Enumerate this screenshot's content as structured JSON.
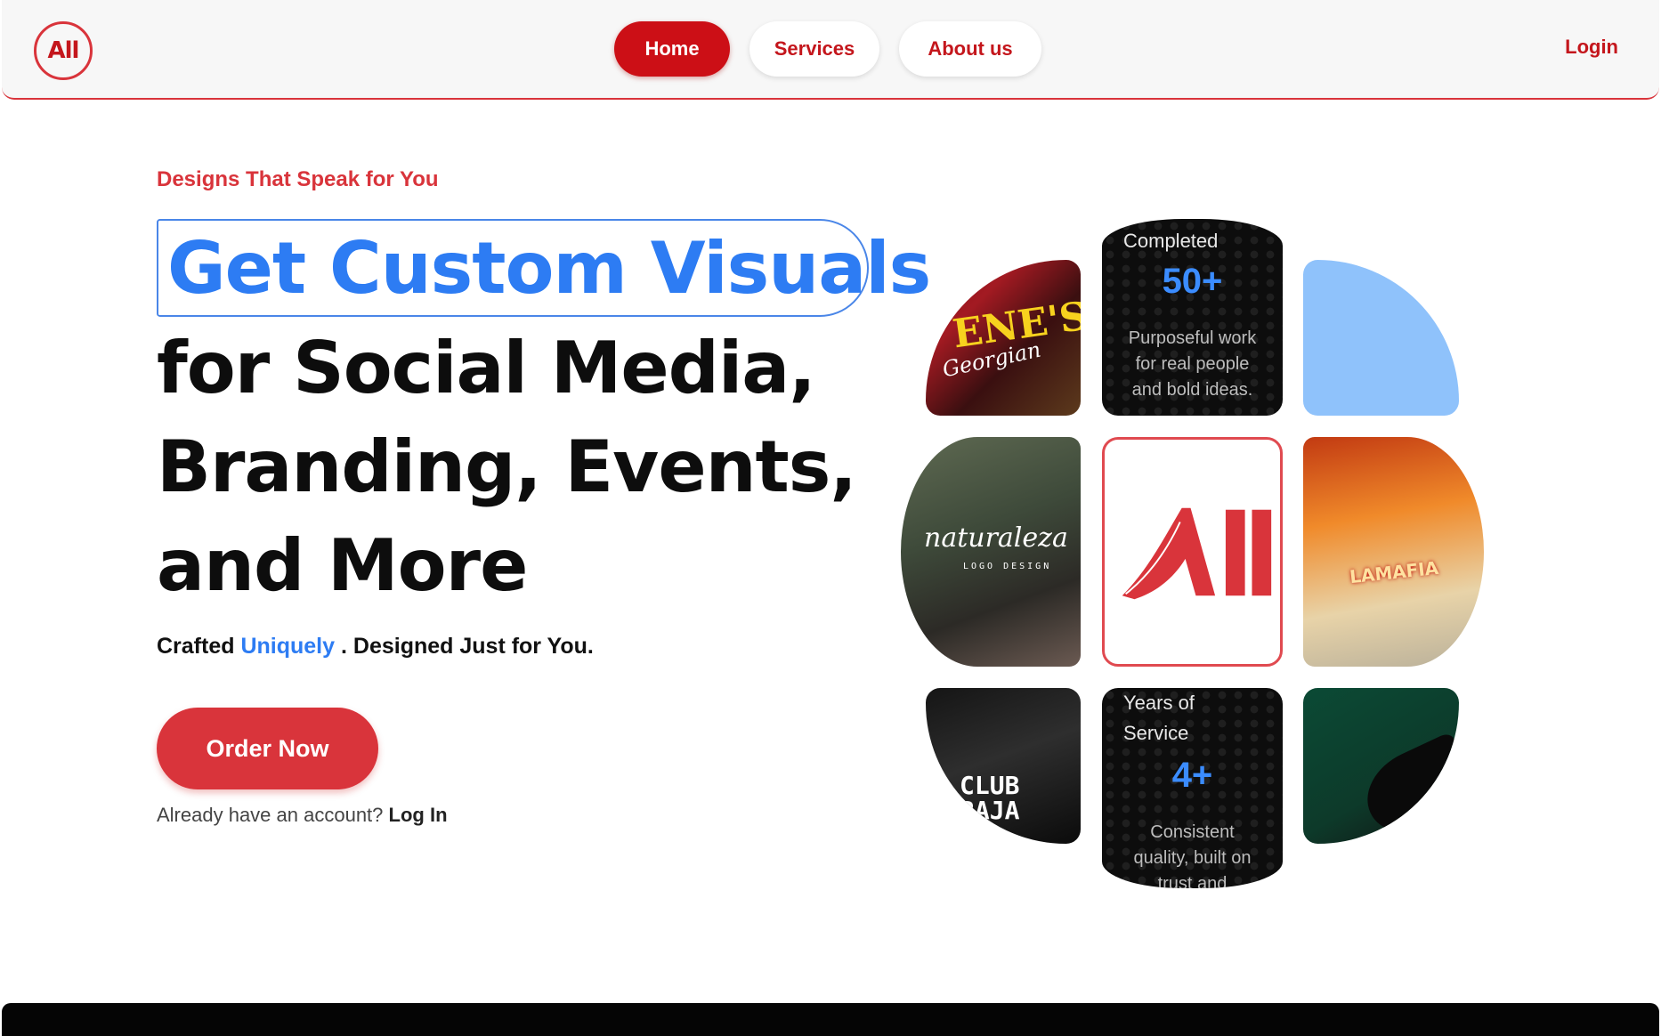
{
  "brand": {
    "logo_text": "All",
    "accent_color": "#d9343b",
    "primary_red": "#cc0f16",
    "highlight_blue": "#2d7cf3"
  },
  "nav": {
    "items": [
      {
        "label": "Home",
        "active": true
      },
      {
        "label": "Services",
        "active": false
      },
      {
        "label": "About us",
        "active": false
      }
    ],
    "login_label": "Login"
  },
  "hero": {
    "tagline": "Designs That Speak for You",
    "headline_highlight": "Get Custom Visuals",
    "headline_lines": [
      "for Social Media,",
      "Branding, Events,",
      "and More"
    ],
    "sub_prefix": "Crafted",
    "sub_highlight": "Uniquely",
    "sub_suffix": ". Designed Just for You.",
    "cta_label": "Order Now",
    "account_prompt": "Already have an account?",
    "account_link": "Log In"
  },
  "gallery": {
    "stat_completed": {
      "title": "Completed",
      "value": "50+",
      "desc_lines": [
        "Purposeful work",
        "for real people",
        "and bold ideas."
      ]
    },
    "stat_years": {
      "title_lines": [
        "Years of",
        "Service"
      ],
      "value": "4+",
      "desc_lines": [
        "Consistent",
        "quality, built on",
        "trust and"
      ]
    },
    "tile_a": {
      "line1": "ENE'S",
      "line2": "Georgian"
    },
    "tile_b": {
      "brand": "naturaleza",
      "sub": "LOGO DESIGN"
    },
    "tile_c": {
      "caption": "LAMAFIA"
    },
    "tile_d": {
      "caption": "CLUB\nRAJA"
    },
    "center_logo": "All"
  }
}
